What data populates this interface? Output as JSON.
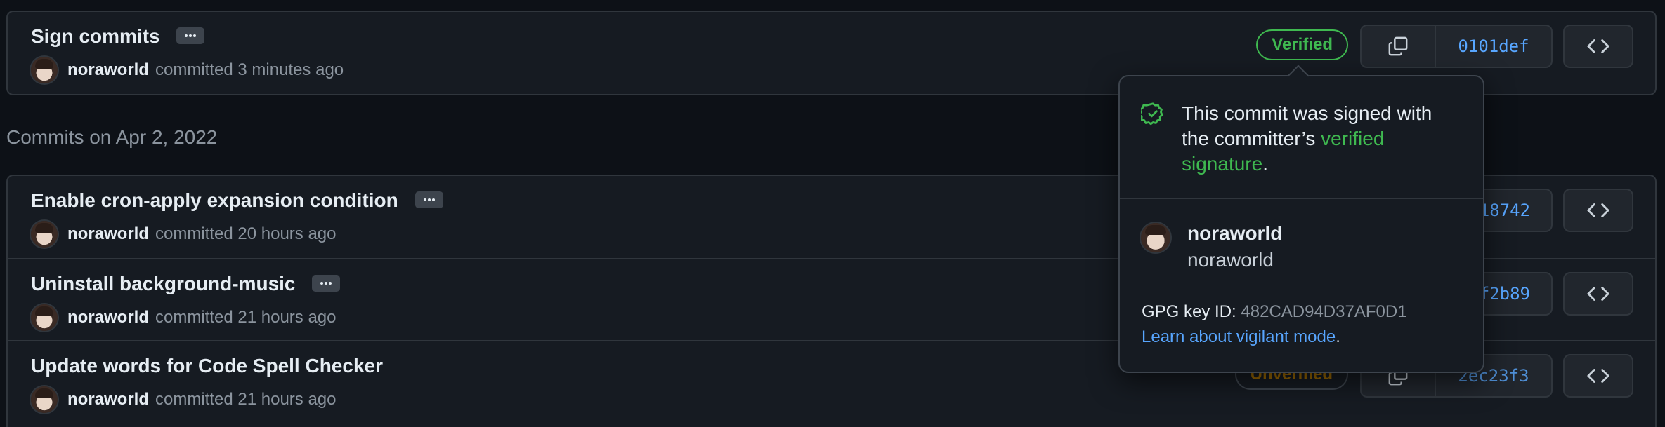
{
  "commits_top": [
    {
      "title": "Sign commits",
      "author": "noraworld",
      "time": "committed 3 minutes ago",
      "badge": "Verified",
      "sha": "0101def"
    }
  ],
  "date_heading": "Commits on Apr 2, 2022",
  "commits": [
    {
      "title": "Enable cron-apply expansion condition",
      "author": "noraworld",
      "time": "committed 20 hours ago",
      "sha_visible": "18742"
    },
    {
      "title": "Uninstall background-music",
      "author": "noraworld",
      "time": "committed 21 hours ago",
      "sha_visible": "f2b89"
    },
    {
      "title": "Update words for Code Spell Checker",
      "author": "noraworld",
      "time": "committed 21 hours ago",
      "badge": "Unverified",
      "sha": "2ec23f3"
    }
  ],
  "popover": {
    "message_pre": "This commit was signed with the committer’s ",
    "message_link": "verified signature",
    "message_post": ".",
    "name": "noraworld",
    "login": "noraworld",
    "gpg_label": "GPG key ID:",
    "gpg_key": "482CAD94D37AF0D1",
    "learn_link": "Learn about vigilant mode",
    "learn_post": "."
  },
  "icons": {
    "copy": "copy-icon",
    "code": "code-icon",
    "check": "check-circle-icon",
    "more": "kebab-horizontal-icon"
  },
  "colors": {
    "background": "#0d1117",
    "verified": "#3fb950",
    "link": "#58a6ff",
    "unverified": "#9e6a03"
  }
}
